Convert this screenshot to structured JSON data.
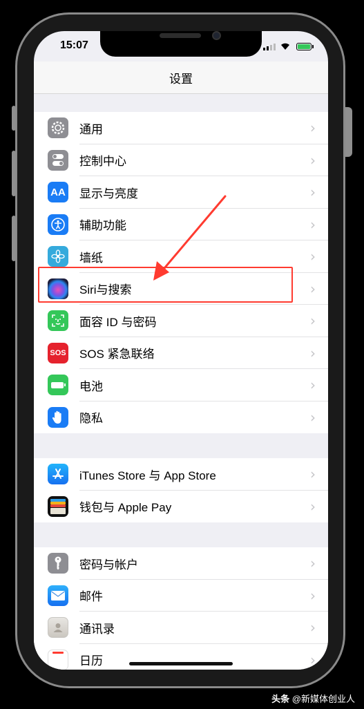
{
  "status_bar": {
    "time": "15:07"
  },
  "nav": {
    "title": "设置"
  },
  "groups": [
    {
      "items": [
        {
          "label": "通用",
          "icon": "gear-icon",
          "color": "#8e8e93"
        },
        {
          "label": "控制中心",
          "icon": "toggles-icon",
          "color": "#8e8e93"
        },
        {
          "label": "显示与亮度",
          "icon": "text-size-icon",
          "color": "#1a7cf5"
        },
        {
          "label": "辅助功能",
          "icon": "accessibility-icon",
          "color": "#1a7cf5"
        },
        {
          "label": "墙纸",
          "icon": "flower-icon",
          "color": "#35aadc"
        },
        {
          "label": "Siri与搜索",
          "icon": "siri-icon",
          "color": "#1c1c3a"
        },
        {
          "label": "面容 ID 与密码",
          "icon": "face-id-icon",
          "color": "#34c759"
        },
        {
          "label": "SOS 紧急联络",
          "icon": "sos-icon",
          "icon_text": "SOS",
          "color": "#e5222d"
        },
        {
          "label": "电池",
          "icon": "battery-icon",
          "color": "#34c759"
        },
        {
          "label": "隐私",
          "icon": "hand-icon",
          "color": "#1a7cf5"
        }
      ]
    },
    {
      "items": [
        {
          "label": "iTunes Store 与 App Store",
          "icon": "app-store-icon",
          "color": "#1a8cf5"
        },
        {
          "label": "钱包与 Apple Pay",
          "icon": "wallet-icon",
          "color": "#111111"
        }
      ]
    },
    {
      "items": [
        {
          "label": "密码与帐户",
          "icon": "key-icon",
          "color": "#8e8e93"
        },
        {
          "label": "邮件",
          "icon": "mail-icon",
          "color": "#1a7cf5"
        },
        {
          "label": "通讯录",
          "icon": "contacts-icon",
          "color": "#d8d5d0"
        },
        {
          "label": "日历",
          "icon": "calendar-icon",
          "color": "#ffffff"
        }
      ]
    }
  ],
  "annotation": {
    "highlight_color": "#ff3b30"
  },
  "watermark": {
    "prefix": "头条",
    "text": "@新媒体创业人"
  }
}
